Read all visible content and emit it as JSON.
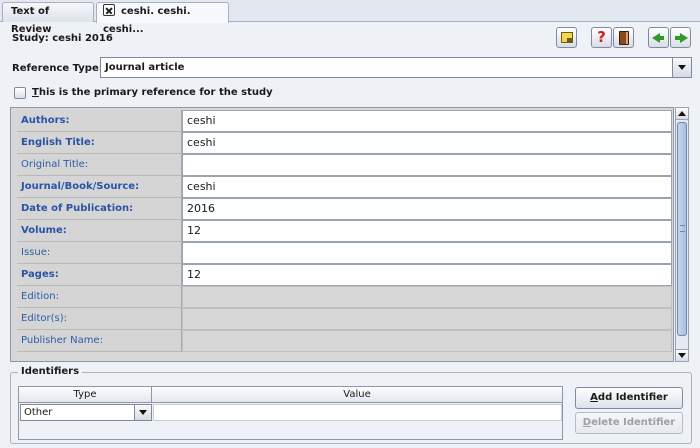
{
  "tabs": [
    {
      "label": "Text of Review"
    },
    {
      "label": "ceshi. ceshi. ceshi..."
    }
  ],
  "header": {
    "study_title": "Study: ceshi 2016",
    "icons": [
      "note-icon",
      "help-icon",
      "book-icon",
      "arrow-left-icon",
      "arrow-right-icon"
    ],
    "help_glyph": "?"
  },
  "reference_type": {
    "label": "Reference Type:",
    "value": "Journal article"
  },
  "primary": {
    "label_first": "T",
    "label_rest": "his is the primary reference for the study",
    "checked": false
  },
  "fields": [
    {
      "label": "Authors:",
      "value": "ceshi",
      "bold": true,
      "enabled": true
    },
    {
      "label": "English Title:",
      "value": "ceshi",
      "bold": true,
      "enabled": true
    },
    {
      "label": "Original Title:",
      "value": "",
      "bold": false,
      "enabled": true
    },
    {
      "label": "Journal/Book/Source:",
      "value": "ceshi",
      "bold": true,
      "enabled": true
    },
    {
      "label": "Date of Publication:",
      "value": "2016",
      "bold": true,
      "enabled": true
    },
    {
      "label": "Volume:",
      "value": "12",
      "bold": true,
      "enabled": true
    },
    {
      "label": "Issue:",
      "value": "",
      "bold": false,
      "enabled": true
    },
    {
      "label": "Pages:",
      "value": "12",
      "bold": true,
      "enabled": true
    },
    {
      "label": "Edition:",
      "value": "",
      "bold": false,
      "enabled": false
    },
    {
      "label": "Editor(s):",
      "value": "",
      "bold": false,
      "enabled": false
    },
    {
      "label": "Publisher Name:",
      "value": "",
      "bold": false,
      "enabled": false
    }
  ],
  "identifiers": {
    "legend": "Identifiers",
    "columns": [
      "Type",
      "Value"
    ],
    "rows": [
      {
        "type": "Other",
        "value": ""
      }
    ],
    "add_label_first": "A",
    "add_label_rest": "dd Identifier",
    "delete_label_first": "D",
    "delete_label_rest": "elete Identifier"
  },
  "colors": {
    "label_text": "#2a53a6",
    "accent_green": "#2f9a2b",
    "help_red": "#d22020"
  }
}
